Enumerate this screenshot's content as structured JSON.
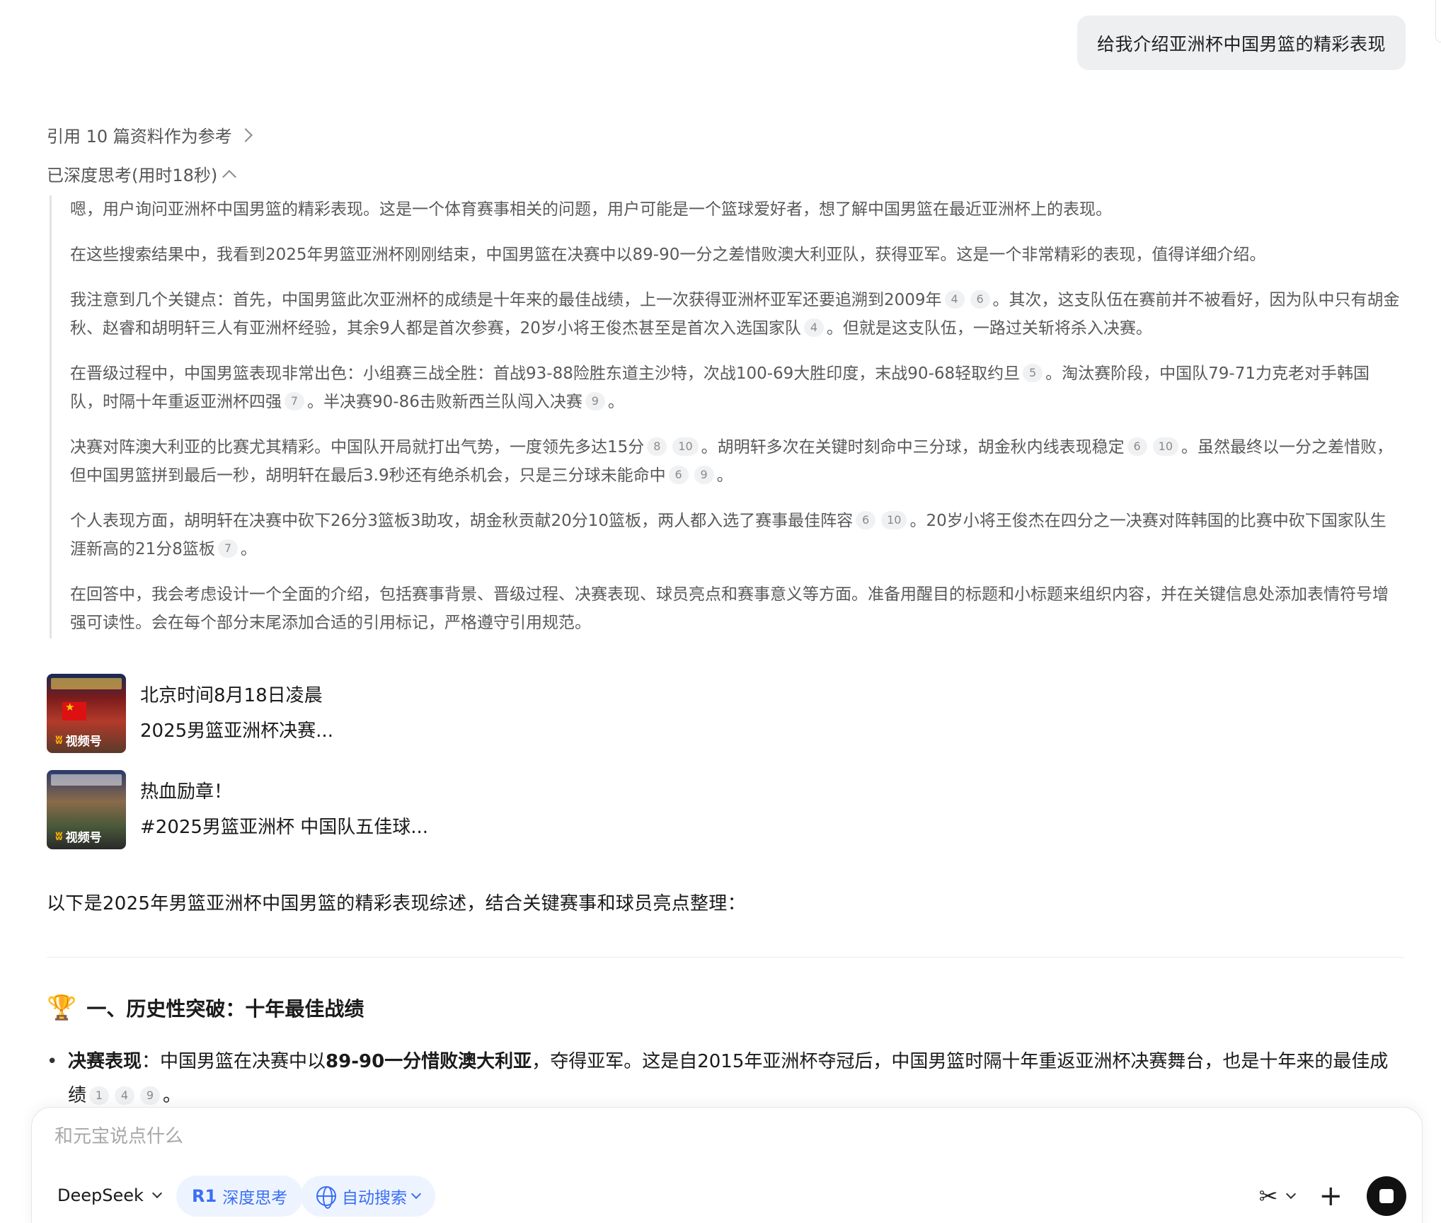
{
  "user_message": "给我介绍亚洲杯中国男篮的精彩表现",
  "references_label": "引用 10 篇资料作为参考",
  "thinking_header": "已深度思考(用时18秒)",
  "thinking": {
    "p1": "嗯，用户询问亚洲杯中国男篮的精彩表现。这是一个体育赛事相关的问题，用户可能是一个篮球爱好者，想了解中国男篮在最近亚洲杯上的表现。",
    "p2": "在这些搜索结果中，我看到2025年男篮亚洲杯刚刚结束，中国男篮在决赛中以89-90一分之差惜败澳大利亚队，获得亚军。这是一个非常精彩的表现，值得详细介绍。",
    "p3a": "我注意到几个关键点：首先，中国男篮此次亚洲杯的成绩是十年来的最佳战绩，上一次获得亚洲杯亚军还要追溯到2009年",
    "p3b": "。其次，这支队伍在赛前并不被看好，因为队中只有胡金秋、赵睿和胡明轩三人有亚洲杯经验，其余9人都是首次参赛，20岁小将王俊杰甚至是首次入选国家队",
    "p3c": "。但就是这支队伍，一路过关斩将杀入决赛。",
    "p4a": "在晋级过程中，中国男篮表现非常出色：小组赛三战全胜：首战93-88险胜东道主沙特，次战100-69大胜印度，末战90-68轻取约旦",
    "p4b": "。淘汰赛阶段，中国队79-71力克老对手韩国队，时隔十年重返亚洲杯四强",
    "p4c": "。半决赛90-86击败新西兰队闯入决赛",
    "p4d": "。",
    "p5a": "决赛对阵澳大利亚的比赛尤其精彩。中国队开局就打出气势，一度领先多达15分",
    "p5b": "。胡明轩多次在关键时刻命中三分球，胡金秋内线表现稳定",
    "p5c": "。虽然最终以一分之差惜败，但中国男篮拼到最后一秒，胡明轩在最后3.9秒还有绝杀机会，只是三分球未能命中",
    "p5d": "。",
    "p6a": "个人表现方面，胡明轩在决赛中砍下26分3篮板3助攻，胡金秋贡献20分10篮板，两人都入选了赛事最佳阵容",
    "p6b": "。20岁小将王俊杰在四分之一决赛对阵韩国的比赛中砍下国家队生涯新高的21分8篮板",
    "p6c": "。",
    "p7": "在回答中，我会考虑设计一个全面的介绍，包括赛事背景、晋级过程、决赛表现、球员亮点和赛事意义等方面。准备用醒目的标题和小标题来组织内容，并在关键信息处添加表情符号增强可读性。会在每个部分末尾添加合适的引用标记，严格遵守引用规范。"
  },
  "citations": {
    "c4": "4",
    "c6": "6",
    "c5": "5",
    "c7": "7",
    "c8": "8",
    "c9": "9",
    "c10": "10",
    "c1": "1"
  },
  "videos": [
    {
      "line1": "北京时间8月18日凌晨",
      "line2": "2025男篮亚洲杯决赛...",
      "badge": "视频号",
      "icon": "channels-logo-icon"
    },
    {
      "line1": "热血励章！",
      "line2": "#2025男篮亚洲杯 中国队五佳球...",
      "badge": "视频号",
      "icon": "channels-logo-icon"
    }
  ],
  "summary": "以下是2025年男篮亚洲杯中国男篮的精彩表现综述，结合关键赛事和球员亮点整理：",
  "section1": {
    "title": "一、历史性突破：十年最佳战绩",
    "bullet_label": "决赛表现",
    "bullet_colon": "：中国男篮在决赛中以",
    "bullet_bold": "89-90一分惜败澳大利亚",
    "bullet_rest": "，夺得亚军。这是自2015年亚洲杯夺冠后，中国男篮时隔十年重返亚洲杯决赛舞台，也是十年来的最佳成绩",
    "bullet_end": "。"
  },
  "composer": {
    "placeholder": "和元宝说点什么",
    "model": "DeepSeek",
    "deep_think_label": "深度思考",
    "deep_think_prefix": "R1",
    "search_label": "自动搜索"
  },
  "colors": {
    "accent": "#3b6ef5",
    "bubble": "#eeeff1",
    "thinking_text": "#595959"
  }
}
